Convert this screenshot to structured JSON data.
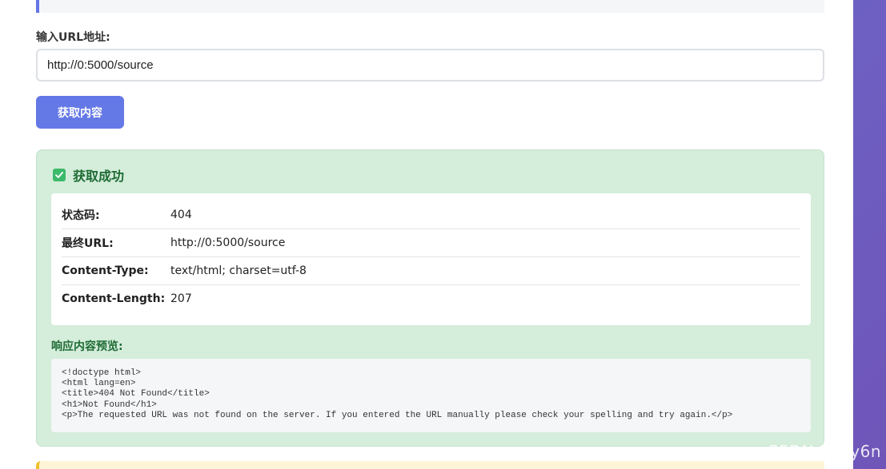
{
  "form": {
    "url_label": "输入URL地址:",
    "url_value": "http://0:5000/source",
    "submit_label": "获取内容"
  },
  "result": {
    "title": "获取成功",
    "rows": [
      {
        "key": "状态码:",
        "value": "404"
      },
      {
        "key": "最终URL:",
        "value": "http://0:5000/source"
      },
      {
        "key": "Content-Type:",
        "value": "text/html; charset=utf-8"
      },
      {
        "key": "Content-Length:",
        "value": "207"
      }
    ],
    "preview_label": "响应内容预览:",
    "preview_lines": [
      "<!doctype html>",
      "<html lang=en>",
      "<title>404 Not Found</title>",
      "<h1>Not Found</h1>",
      "<p>The requested URL was not found on the server. If you entered the URL manually please check your spelling and try again.</p>"
    ]
  },
  "watermark": "CSDN @My6n",
  "icons": {
    "success": "checkbox-checked-icon"
  },
  "colors": {
    "accent": "#6478e6",
    "success_bg": "#d5eddb",
    "success_text": "#1d6b33",
    "warning_bg": "#fff5d6"
  }
}
